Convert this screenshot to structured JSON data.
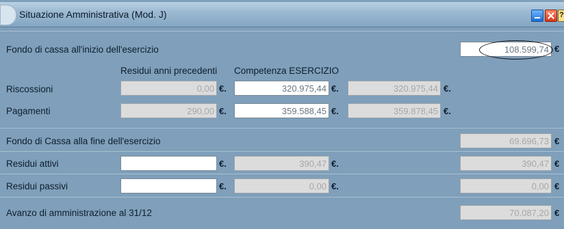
{
  "window": {
    "title": "Situazione Amministrativa (Mod. J)",
    "help_glyph": "?"
  },
  "currency": "€",
  "currency_dot": "€.",
  "columns": {
    "residui": "Residui anni precedenti",
    "competenza": "Competenza ESERCIZIO"
  },
  "fondo_inizio": {
    "label": "Fondo di cassa all'inizio dell'esercizio",
    "value": "108.599,74"
  },
  "riscossioni": {
    "label": "Riscossioni",
    "residui": "0,00",
    "competenza": "320.975,44",
    "totale": "320.975,44"
  },
  "pagamenti": {
    "label": "Pagamenti",
    "residui": "290,00",
    "competenza": "359.588,45",
    "totale": "359.878,45"
  },
  "fondo_fine": {
    "label": "Fondo di Cassa alla fine dell'esercizio",
    "value": "69.696,73"
  },
  "residui_attivi": {
    "label": "Residui attivi",
    "input": "",
    "competenza": "390,47",
    "value": "390,47"
  },
  "residui_passivi": {
    "label": "Residui passivi",
    "input": "",
    "competenza": "0,00",
    "value": "0,00"
  },
  "avanzo": {
    "label": "Avanzo di amministrazione al 31/12",
    "value": "70.087,20"
  },
  "colors": {
    "panel": "#7f9fba",
    "readonly_field": "#dcdcdc",
    "editable_field": "#ffffff"
  }
}
